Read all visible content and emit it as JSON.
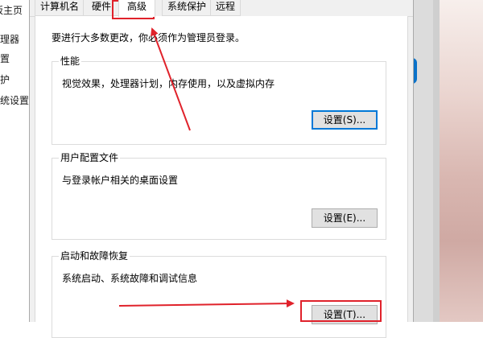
{
  "background_left": {
    "items": [
      "板主页",
      "理器",
      "置",
      "护",
      "统设置"
    ]
  },
  "dialog": {
    "tabs": [
      {
        "label": "计算机名"
      },
      {
        "label": "硬件"
      },
      {
        "label": "高级"
      },
      {
        "label": "系统保护"
      },
      {
        "label": "远程"
      }
    ],
    "active_tab": "高级",
    "notice": "要进行大多数更改，你必须作为管理员登录。",
    "groups": {
      "performance": {
        "title": "性能",
        "description": "视觉效果，处理器计划，内存使用，以及虚拟内存",
        "button": "设置(S)..."
      },
      "user_profiles": {
        "title": "用户配置文件",
        "description": "与登录帐户相关的桌面设置",
        "button": "设置(E)..."
      },
      "startup_recovery": {
        "title": "启动和故障恢复",
        "description": "系统启动、系统故障和调试信息",
        "button": "设置(T)..."
      }
    }
  },
  "annotations": {
    "color": "#e0222b"
  }
}
